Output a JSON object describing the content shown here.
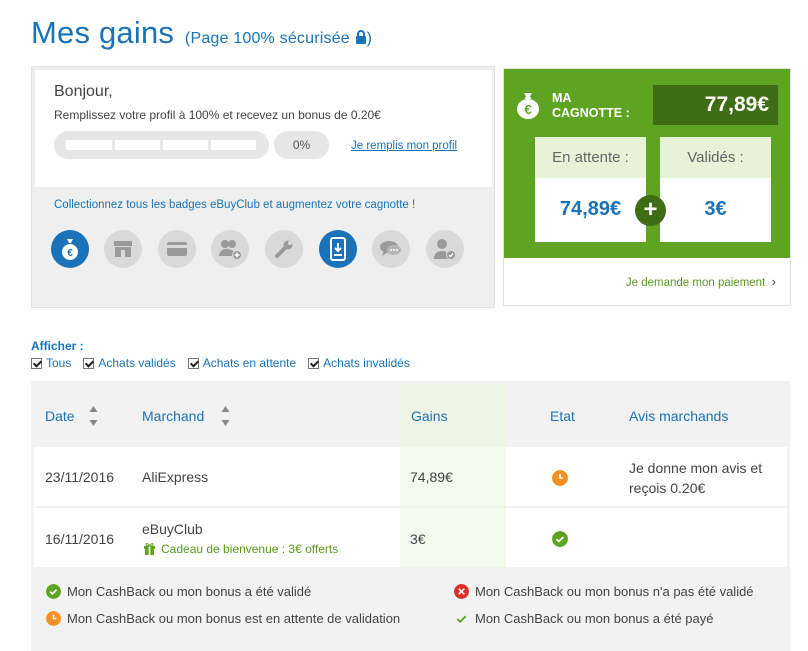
{
  "header": {
    "title": "Mes gains",
    "subtitle": "(Page 100% sécurisée",
    "subtitle_end": ")"
  },
  "profile": {
    "greeting": "Bonjour,",
    "promo": "Remplissez votre profil à 100% et recevez un bonus de 0.20€",
    "progress_label": "0%",
    "progress_value": 0,
    "link": "Je remplis mon profil",
    "badges_text": "Collectionnez tous les badges eBuyClub et augmentez votre cagnotte !",
    "badges": [
      {
        "icon": "euro-bag-icon",
        "active": true
      },
      {
        "icon": "shop-icon",
        "active": false
      },
      {
        "icon": "credit-card-icon",
        "active": false
      },
      {
        "icon": "add-user-icon",
        "active": false
      },
      {
        "icon": "wrench-icon",
        "active": false
      },
      {
        "icon": "mobile-app-icon",
        "active": true
      },
      {
        "icon": "chat-icon",
        "active": false
      },
      {
        "icon": "verified-user-icon",
        "active": false
      }
    ]
  },
  "cagnotte": {
    "title_line1": "MA",
    "title_line2": "CAGNOTTE :",
    "total": "77,89€",
    "pending_label": "En attente :",
    "pending_value": "74,89€",
    "plus": "+",
    "validated_label": "Validés :",
    "validated_value": "3€",
    "payment_link": "Je demande mon paiement",
    "chevron": "›"
  },
  "filters": {
    "label": "Afficher :",
    "options": [
      {
        "label": "Tous",
        "checked": true
      },
      {
        "label": "Achats validés",
        "checked": true
      },
      {
        "label": "Achats en attente",
        "checked": true
      },
      {
        "label": "Achats invalidés",
        "checked": true
      }
    ]
  },
  "table": {
    "headers": {
      "date": "Date",
      "merchant": "Marchand",
      "gains": "Gains",
      "state": "Etat",
      "reviews": "Avis marchands"
    },
    "rows": [
      {
        "date": "23/11/2016",
        "merchant": "AliExpress",
        "gift": "",
        "gains": "74,89€",
        "state": "pending",
        "review": "Je donne mon avis et reçois 0.20€"
      },
      {
        "date": "16/11/2016",
        "merchant": "eBuyClub",
        "gift": "Cadeau de bienvenue : 3€ offerts",
        "gains": "3€",
        "state": "validated",
        "review": ""
      }
    ]
  },
  "legend": {
    "validated": "Mon CashBack ou mon bonus a été validé",
    "pending": "Mon CashBack ou mon bonus est en attente de validation",
    "invalid": "Mon CashBack ou mon bonus n'a pas été validé",
    "paid": "Mon CashBack ou mon bonus a été payé"
  },
  "colors": {
    "brand_blue": "#1a73b8",
    "cagnotte_green": "#5fa322",
    "cagnotte_dark": "#3f6d16",
    "pending_orange": "#f39222",
    "validated_green": "#5fa322",
    "invalid_red": "#d9302c"
  }
}
